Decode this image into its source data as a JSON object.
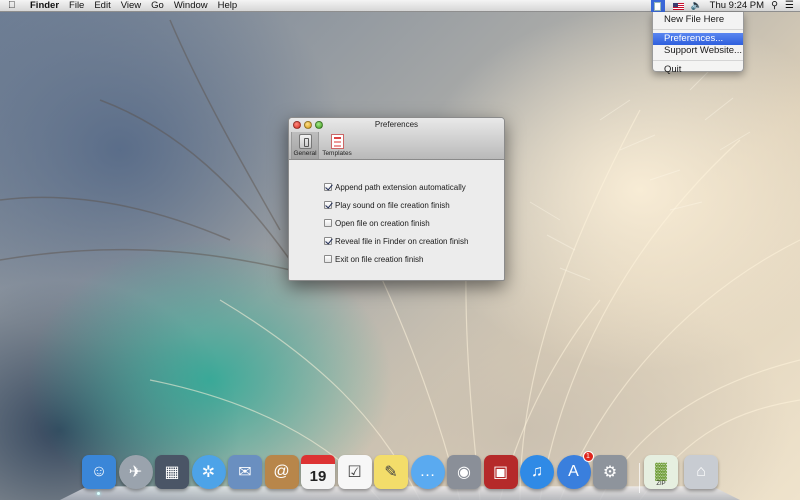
{
  "menubar": {
    "app_name": "Finder",
    "menus": [
      "File",
      "Edit",
      "View",
      "Go",
      "Window",
      "Help"
    ],
    "clock": "Thu 9:24 PM"
  },
  "status_menu": {
    "items": [
      {
        "label": "New File Here",
        "highlighted": false
      },
      {
        "label": "Preferences...",
        "highlighted": true
      },
      {
        "label": "Support Website...",
        "highlighted": false
      },
      {
        "label": "Quit",
        "highlighted": false
      }
    ]
  },
  "prefs_window": {
    "title": "Preferences",
    "tabs": [
      {
        "label": "General",
        "icon": "general-switch-icon",
        "selected": true
      },
      {
        "label": "Templates",
        "icon": "templates-document-icon",
        "selected": false
      }
    ],
    "options": [
      {
        "label": "Append path extension automatically",
        "checked": true
      },
      {
        "label": "Play sound on file creation finish",
        "checked": true
      },
      {
        "label": "Open file on creation finish",
        "checked": false
      },
      {
        "label": "Reveal file in Finder on creation finish",
        "checked": true
      },
      {
        "label": "Exit on file creation finish",
        "checked": false
      }
    ]
  },
  "dock": {
    "apps": [
      {
        "name": "finder-icon",
        "color": "#3a86d8"
      },
      {
        "name": "launchpad-icon",
        "color": "#9aa3ad"
      },
      {
        "name": "mission-control-icon",
        "color": "#4a5566"
      },
      {
        "name": "safari-icon",
        "color": "#4da3e8"
      },
      {
        "name": "mail-icon",
        "color": "#6a8fc0"
      },
      {
        "name": "contacts-icon",
        "color": "#b8864a"
      },
      {
        "name": "calendar-icon",
        "color": "#f4f4f4",
        "text": "19"
      },
      {
        "name": "reminders-icon",
        "color": "#f7f7f7"
      },
      {
        "name": "notes-icon",
        "color": "#f3dd6a"
      },
      {
        "name": "messages-icon",
        "color": "#5aaaf0"
      },
      {
        "name": "facetime-icon",
        "color": "#8a8f98"
      },
      {
        "name": "photo-booth-icon",
        "color": "#b52a2a"
      },
      {
        "name": "itunes-icon",
        "color": "#2f8ae6"
      },
      {
        "name": "app-store-icon",
        "color": "#3a7fdd",
        "badge": "1"
      },
      {
        "name": "system-preferences-icon",
        "color": "#8e949c"
      },
      {
        "name": "archive-utility-icon",
        "color": "#e6efe0",
        "text": "ZIP"
      },
      {
        "name": "trash-icon",
        "color": "#c8ccd2"
      }
    ]
  }
}
